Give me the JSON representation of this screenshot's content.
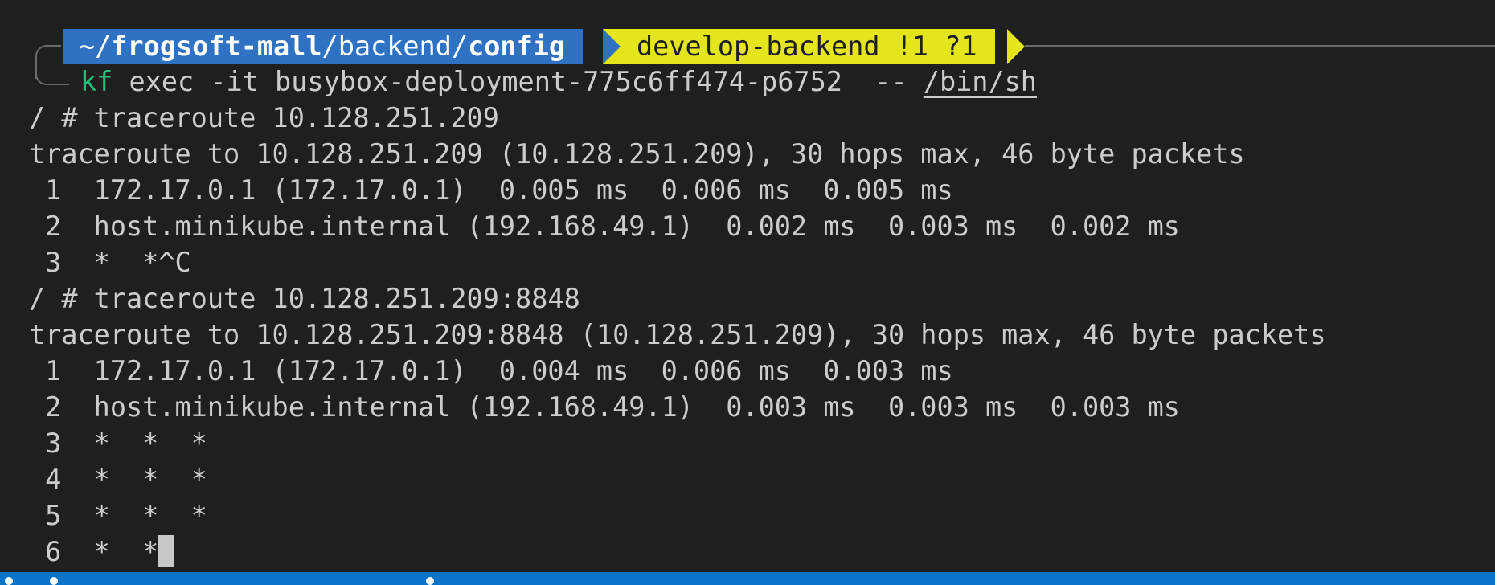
{
  "prompt": {
    "path_prefix": "~/",
    "path_bold1": "frogsoft-mall",
    "path_mid": "/backend/",
    "path_bold2": "config",
    "git_branch": "develop-backend",
    "git_status": "!1 ?1",
    "path_bg_color": "#2f72c4",
    "git_bg_color": "#e5e51c"
  },
  "command": {
    "program": "kf",
    "args": " exec -it busybox-deployment-775c6ff474-p6752  -- ",
    "shell": "/bin/sh"
  },
  "lines": [
    "/ # traceroute 10.128.251.209",
    "traceroute to 10.128.251.209 (10.128.251.209), 30 hops max, 46 byte packets",
    " 1  172.17.0.1 (172.17.0.1)  0.005 ms  0.006 ms  0.005 ms",
    " 2  host.minikube.internal (192.168.49.1)  0.002 ms  0.003 ms  0.002 ms",
    " 3  *  *^C",
    "/ # traceroute 10.128.251.209:8848",
    "traceroute to 10.128.251.209:8848 (10.128.251.209), 30 hops max, 46 byte packets",
    " 1  172.17.0.1 (172.17.0.1)  0.004 ms  0.006 ms  0.003 ms",
    " 2  host.minikube.internal (192.168.49.1)  0.003 ms  0.003 ms  0.003 ms",
    " 3  *  *  *",
    " 4  *  *  *",
    " 5  *  *  *"
  ],
  "last_line": " 6  *  *",
  "statusbar_color": "#0b74c8"
}
